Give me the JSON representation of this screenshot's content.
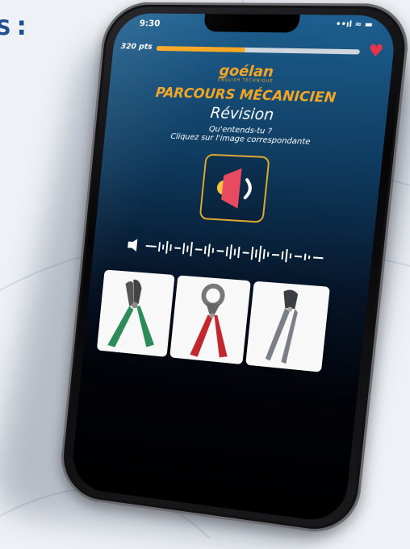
{
  "background": {
    "heading_fragment": "s:"
  },
  "status_bar": {
    "time": "9:30",
    "icons_text": "••ıl ≈ ▬"
  },
  "progress": {
    "points_label": "320 pts",
    "fill_fraction": 0.45,
    "accent": "#f5a623",
    "heart_color": "#e8344a"
  },
  "logo": {
    "name": "goélan",
    "tagline": "ENGLISH TECHNIQUE"
  },
  "title": "PARCOURS MÉCANICIEN",
  "subtitle": "Révision",
  "question": {
    "line1": "Qu'entends-tu ?",
    "line2": "Cliquez sur l'image correspondante"
  },
  "sound_button": {
    "icon": "speaker-icon"
  },
  "audio": {
    "icon": "speaker-small-icon",
    "wave": "waveform"
  },
  "choices": [
    {
      "name": "wire-stripper-green",
      "icon": "wire-stripper-icon",
      "color": "#2e8b57"
    },
    {
      "name": "cable-cutter-red",
      "icon": "cable-cutter-icon",
      "color": "#c0282d"
    },
    {
      "name": "pliers-grey",
      "icon": "pliers-icon",
      "color": "#7a7f86"
    }
  ]
}
